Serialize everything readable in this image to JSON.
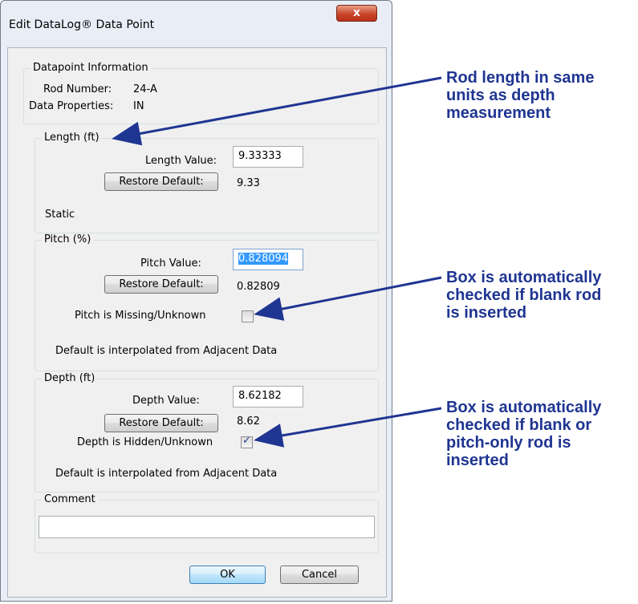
{
  "window": {
    "title": "Edit DataLog® Data Point",
    "close_glyph": "x"
  },
  "info": {
    "legend": "Datapoint Information",
    "rod_number_label": "Rod Number:",
    "rod_number_value": "24-A",
    "data_props_label": "Data Properties:",
    "data_props_value": "IN"
  },
  "length": {
    "legend": "Length (ft)",
    "value_label": "Length Value:",
    "value": "9.33333",
    "restore_label": "Restore Default:",
    "default_value": "9.33",
    "status": "Static"
  },
  "pitch": {
    "legend": "Pitch (%)",
    "value_label": "Pitch Value:",
    "value": "0.828094",
    "restore_label": "Restore Default:",
    "default_value": "0.82809",
    "missing_label": "Pitch is Missing/Unknown",
    "missing_checked": false,
    "note": "Default is interpolated from Adjacent Data"
  },
  "depth": {
    "legend": "Depth (ft)",
    "value_label": "Depth Value:",
    "value": "8.62182",
    "restore_label": "Restore Default:",
    "default_value": "8.62",
    "hidden_label": "Depth is Hidden/Unknown",
    "hidden_checked": true,
    "note": "Default is interpolated from Adjacent Data"
  },
  "comment": {
    "legend": "Comment",
    "value": ""
  },
  "buttons": {
    "ok": "OK",
    "cancel": "Cancel"
  },
  "annotations": {
    "a1": [
      "Rod length in same",
      "units as depth",
      "measurement"
    ],
    "a2": [
      "Box is automatically",
      "checked if blank rod",
      "is inserted"
    ],
    "a3": [
      "Box is automatically",
      "checked if blank or",
      "pitch-only rod is",
      "inserted"
    ],
    "color": "#1f3592"
  }
}
